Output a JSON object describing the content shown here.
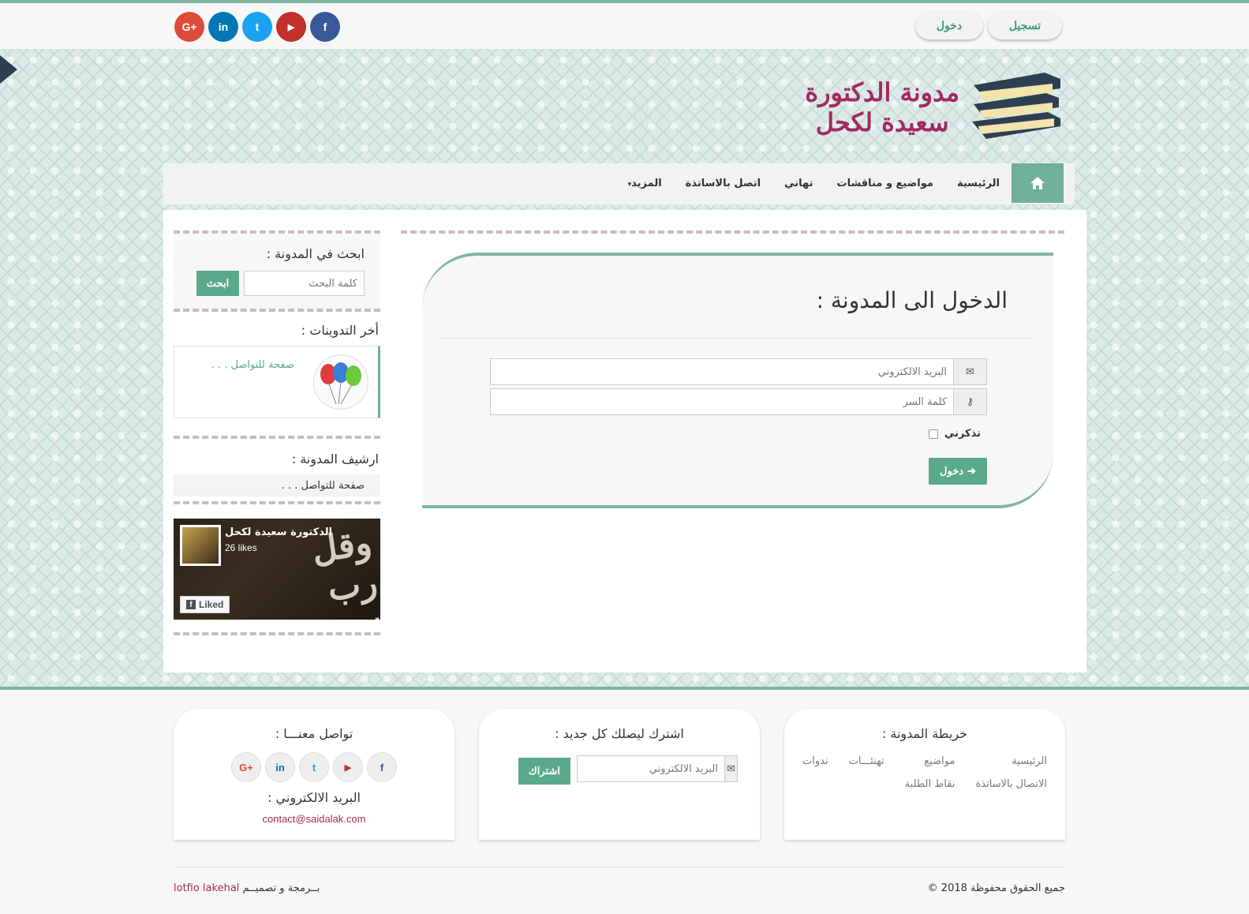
{
  "topbar": {
    "register_label": "تسجيل",
    "login_label": "دخول",
    "social": [
      {
        "icon": "facebook-icon",
        "glyph": "f",
        "color": "#3b5998"
      },
      {
        "icon": "youtube-icon",
        "glyph": "▶",
        "color": "#c4302b"
      },
      {
        "icon": "twitter-icon",
        "glyph": "t",
        "color": "#1da1f2"
      },
      {
        "icon": "linkedin-icon",
        "glyph": "in",
        "color": "#0077b5"
      },
      {
        "icon": "google-plus-icon",
        "glyph": "G+",
        "color": "#dd4b39"
      }
    ]
  },
  "header": {
    "logo_line1": "مدونة الدكتورة",
    "logo_line2": "سعيدة لكحل"
  },
  "nav": {
    "home_icon": "home-icon",
    "items": [
      "الرئيسية",
      "مواضيع و مناقشات",
      "تهاني",
      "اتصل بالاساتذة",
      "المزيد"
    ]
  },
  "login": {
    "title": "الدخول الى المدونة :",
    "email_placeholder": "البريد الالكتروني",
    "password_placeholder": "كلمة السر",
    "remember_label": "تذكرني",
    "submit_label": "دخول"
  },
  "sidebar": {
    "search_title": "ابحث في المدونة :",
    "search_placeholder": "كلمة البحث",
    "search_button": "ابحث",
    "recent_title": "أخر التدوينات :",
    "recent_post": "صفحة للتواصل . . .",
    "archive_title": "ارشيف المدونة :",
    "archive_item": "صفحة للتواصل . . .",
    "fb_name": "الدكتورة سعيدة لكحل",
    "fb_likes": "26 likes",
    "fb_liked": "Liked"
  },
  "footer": {
    "sitemap_title": "خريطة المدونة :",
    "sitemap_links": [
      "الرئيسية",
      "مواضيع",
      "تهنئـــات",
      "ندوات",
      "الاتصال بالاساتذة",
      "نقاط الطلبة"
    ],
    "subscribe_title": "اشترك ليصلك كل جديد :",
    "subscribe_placeholder": "البريد الالكتروني",
    "subscribe_button": "اشتراك",
    "contact_title": "تواصل معنـــا :",
    "email_title": "البريد الالكتروني :",
    "email": "contact@saidalak.com",
    "copyright": "جميع الحقوق محفوظة 2018 ©",
    "credits_prefix": "بــرمجة و تصميــم",
    "credits_name": "lotfio lakehal"
  }
}
